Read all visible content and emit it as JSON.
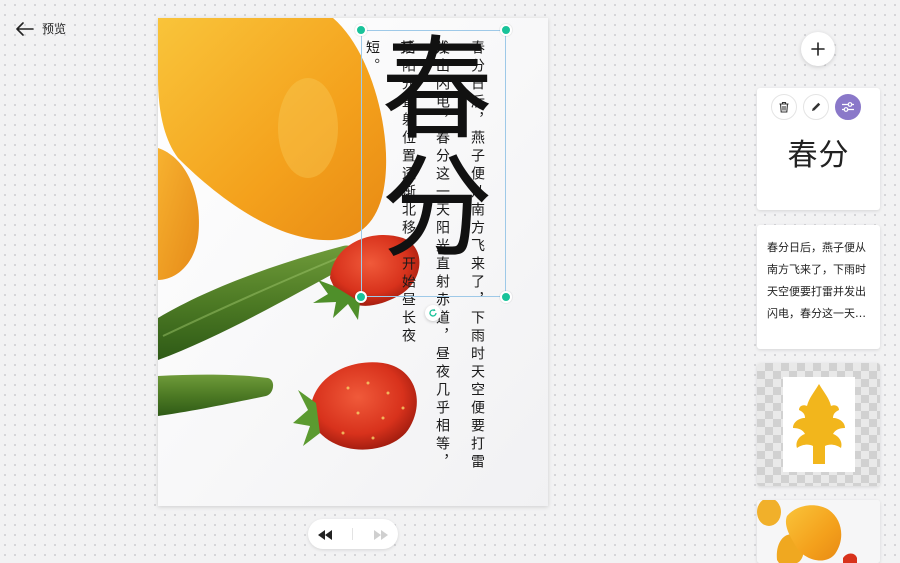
{
  "header": {
    "back_label": "预览"
  },
  "canvas": {
    "title": "春分",
    "paragraph_right": "春分日后，燕子便从南方飞来了，下雨时天空便要打雷并",
    "paragraph_middle": "发出闪电，春分这一天阳光直射赤道，昼夜几乎相等，其",
    "paragraph_left": "后阳光直射位置逐渐北移，开始昼长夜短。"
  },
  "pager": {
    "prev_icon": "rewind-icon",
    "next_icon": "fast-forward-icon"
  },
  "sidebar": {
    "add_icon": "plus-icon",
    "title_card": {
      "text": "春分",
      "tools": [
        "trash-icon",
        "pencil-icon",
        "sliders-icon"
      ]
    },
    "text_card": {
      "text": "春分日后，燕子便从南方飞来了，下雨时天空便要打雷并发出闪电，春分这一天阳光直射赤道，昼夜几乎相等，其后阳光直射位置逐渐北移，开始昼长夜短。"
    }
  },
  "colors": {
    "handle": "#19c39a",
    "accent_purple": "#8a78c9",
    "selection_outline": "#9ec9e8"
  }
}
